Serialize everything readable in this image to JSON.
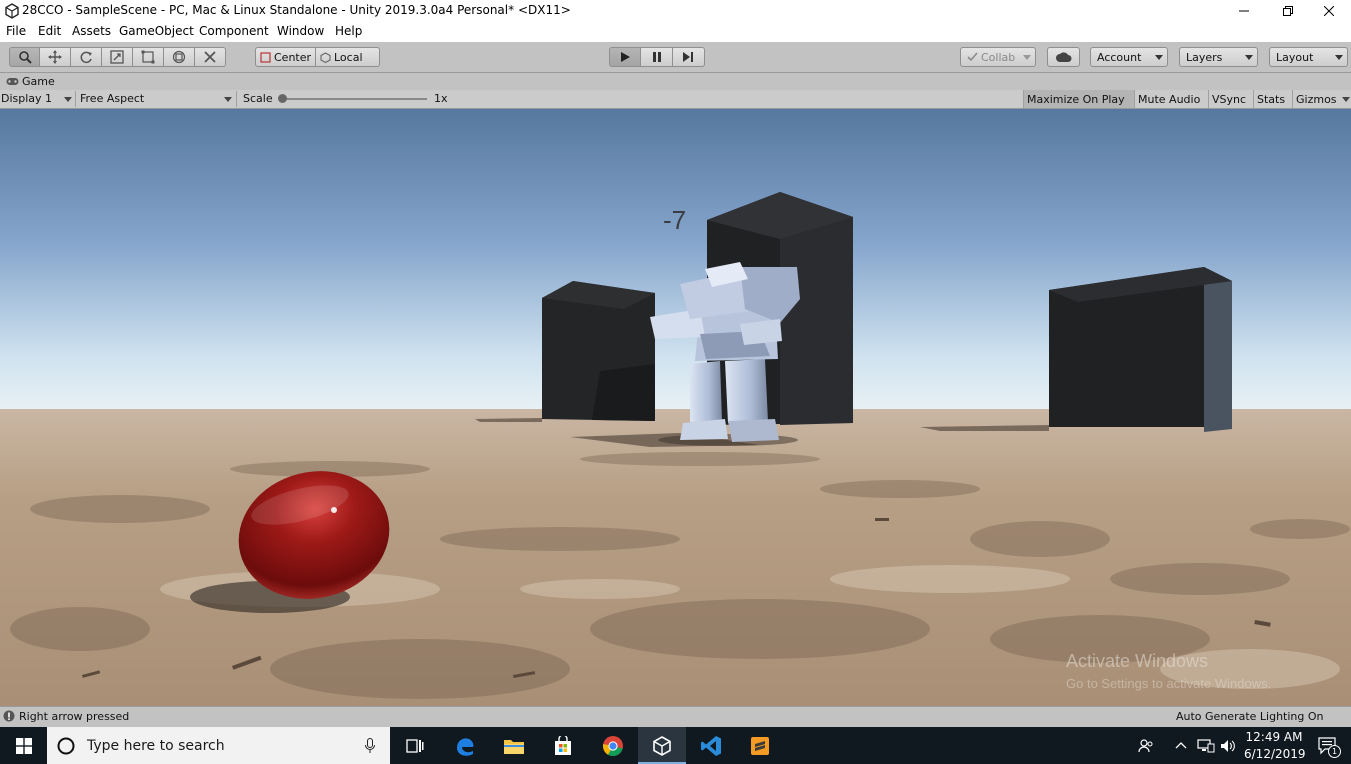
{
  "window": {
    "title": "28CCO - SampleScene - PC, Mac & Linux Standalone - Unity 2019.3.0a4 Personal* <DX11>"
  },
  "menu": [
    "File",
    "Edit",
    "Assets",
    "GameObject",
    "Component",
    "Window",
    "Help"
  ],
  "toolbar": {
    "pivot_label": "Center",
    "space_label": "Local",
    "collab_label": "Collab",
    "account_label": "Account",
    "layers_label": "Layers",
    "layout_label": "Layout"
  },
  "game_view": {
    "tab_label": "Game",
    "display_label": "Display 1",
    "aspect_label": "Free Aspect",
    "scale_label": "Scale",
    "scale_value": "1x",
    "scale_fraction": 0,
    "toggles": [
      "Maximize On Play",
      "Mute Audio",
      "VSync",
      "Stats",
      "Gizmos"
    ]
  },
  "scene": {
    "score_text": "-7",
    "watermark_title": "Activate Windows",
    "watermark_sub": "Go to Settings to activate Windows."
  },
  "status": {
    "message": "Right arrow pressed",
    "lighting": "Auto Generate Lighting On"
  },
  "taskbar": {
    "search_placeholder": "Type here to search",
    "time": "12:49 AM",
    "date": "6/12/2019",
    "notification_count": "1"
  },
  "colors": {
    "toolbar_bg": "#c2c2c2",
    "taskbar_bg": "#101820",
    "sky_top": "#56779f",
    "sand": "#b79f85",
    "ball_red": "#9e1a18"
  }
}
